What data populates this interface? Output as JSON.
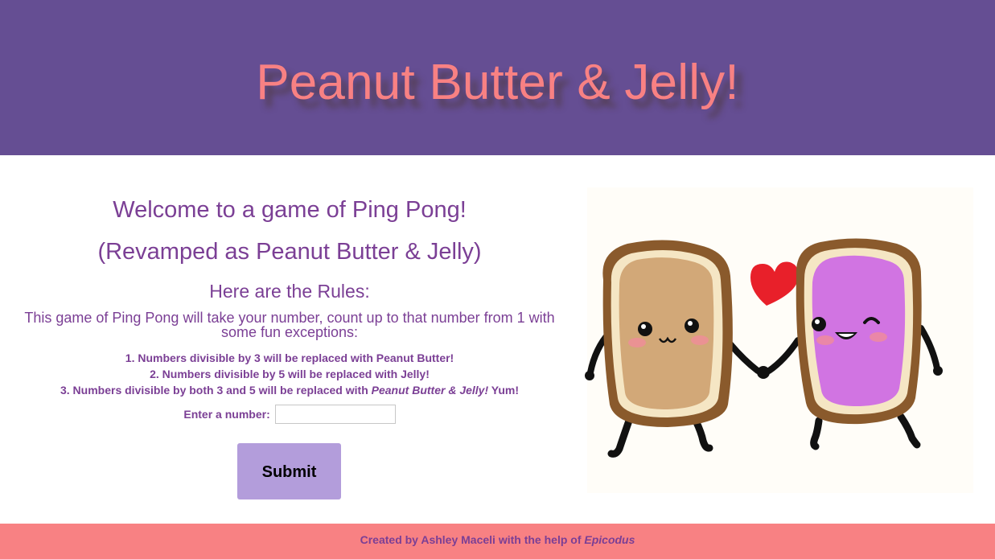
{
  "header": {
    "title": "Peanut Butter & Jelly!",
    "background": "#654e93",
    "title_color": "#f88183"
  },
  "intro": {
    "welcome": "Welcome to a game of Ping Pong!",
    "revamped": "(Revamped as Peanut Butter & Jelly)",
    "rules_heading": "Here are the Rules:",
    "rules_intro": "This game of Ping Pong will take your number, count up to that number from 1 with some fun exceptions:",
    "rules": [
      {
        "text": "1. Numbers divisible by 3 will be replaced with Peanut Butter!"
      },
      {
        "text": "2. Numbers divisible by 5 will be replaced with Jelly!"
      },
      {
        "prefix": "3. Numbers divisible by both 3 and 5 will be replaced with ",
        "emphasis": "Peanut Butter & Jelly!",
        "suffix": " Yum!"
      }
    ],
    "text_color": "#7b3f95"
  },
  "form": {
    "label": "Enter a number:",
    "input_value": "",
    "input_placeholder": "",
    "submit_label": "Submit",
    "submit_color": "#b39ddb"
  },
  "illustration": {
    "icon": "peanut-butter-and-jelly-toast-holding-hands",
    "heart_color": "#e8202a"
  },
  "footer": {
    "prefix": "Created by Ashley Maceli with the help of ",
    "link": "Epicodus",
    "background": "#f88183"
  }
}
